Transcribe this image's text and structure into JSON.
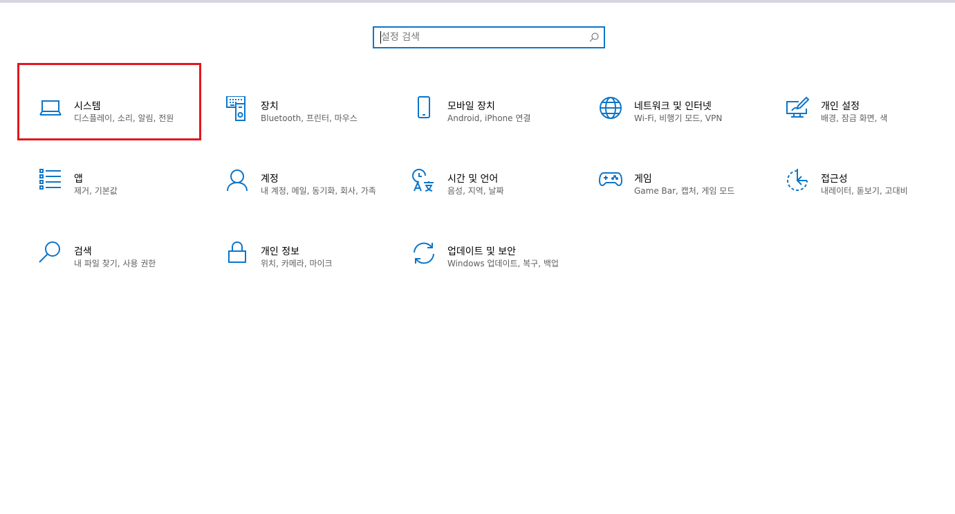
{
  "search": {
    "placeholder": "설정 검색",
    "icon": "search-icon"
  },
  "colors": {
    "accent": "#0b75c9",
    "highlight": "#e3161e",
    "title": "#000000",
    "description": "#5d5d5d"
  },
  "tiles": [
    {
      "title": "시스템",
      "desc": "디스플레이, 소리, 알림, 전원",
      "icon": "laptop-icon",
      "selected": true
    },
    {
      "title": "장치",
      "desc": "Bluetooth, 프린터, 마우스",
      "icon": "devices-icon"
    },
    {
      "title": "모바일 장치",
      "desc": "Android, iPhone 연결",
      "icon": "phone-icon"
    },
    {
      "title": "네트워크 및 인터넷",
      "desc": "Wi-Fi, 비행기 모드, VPN",
      "icon": "globe-icon"
    },
    {
      "title": "개인 설정",
      "desc": "배경, 잠금 화면, 색",
      "icon": "personalization-icon"
    },
    {
      "title": "앱",
      "desc": "제거, 기본값",
      "icon": "apps-list-icon"
    },
    {
      "title": "계정",
      "desc": "내 계정, 메일, 동기화, 회사, 가족",
      "icon": "person-icon"
    },
    {
      "title": "시간 및 언어",
      "desc": "음성, 지역, 날짜",
      "icon": "time-language-icon"
    },
    {
      "title": "게임",
      "desc": "Game Bar, 캡처, 게임 모드",
      "icon": "gamepad-icon"
    },
    {
      "title": "접근성",
      "desc": "내레이터, 돋보기, 고대비",
      "icon": "ease-of-access-icon"
    },
    {
      "title": "검색",
      "desc": "내 파일 찾기, 사용 권한",
      "icon": "search-icon"
    },
    {
      "title": "개인 정보",
      "desc": "위치, 카메라, 마이크",
      "icon": "lock-icon"
    },
    {
      "title": "업데이트 및 보안",
      "desc": "Windows 업데이트, 복구, 백업",
      "icon": "update-sync-icon"
    }
  ]
}
